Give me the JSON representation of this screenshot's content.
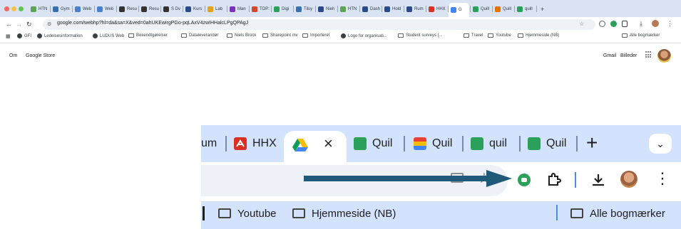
{
  "window": {
    "title": "google.com/webhp",
    "traffic_lights": [
      "#ed6a5e",
      "#f5bf4f",
      "#61c554"
    ]
  },
  "tabs": [
    {
      "label": "HTN",
      "icon": "globe-icon",
      "color": "#5aa454"
    },
    {
      "label": "Gym",
      "icon": "gym-icon",
      "color": "#3a6fb0"
    },
    {
      "label": "Web",
      "icon": "doc-icon",
      "color": "#4a7fd0"
    },
    {
      "label": "Web",
      "icon": "doc-icon",
      "color": "#4a7fd0"
    },
    {
      "label": "Resu",
      "icon": "github-icon",
      "color": "#333333"
    },
    {
      "label": "Resu",
      "icon": "github-icon",
      "color": "#333333"
    },
    {
      "label": "S Dv",
      "icon": "github-icon",
      "color": "#333333"
    },
    {
      "label": "Kurs",
      "icon": "lectio-icon",
      "color": "#2a4a8a"
    },
    {
      "label": "Lab",
      "icon": "lab-icon",
      "color": "#e3a21a"
    },
    {
      "label": "Man",
      "icon": "mail-icon",
      "color": "#7b2fbf"
    },
    {
      "label": "TOP:",
      "icon": "top-icon",
      "color": "#d9432a"
    },
    {
      "label": "Digi",
      "icon": "digi-icon",
      "color": "#2aa05a"
    },
    {
      "label": "Tilsy",
      "icon": "tilsy-icon",
      "color": "#3a6fb0"
    },
    {
      "label": "Nieh",
      "icon": "lectio-icon",
      "color": "#2a4a8a"
    },
    {
      "label": "HTN",
      "icon": "globe-icon",
      "color": "#5aa454"
    },
    {
      "label": "Dash",
      "icon": "lectio-icon",
      "color": "#2a4a8a"
    },
    {
      "label": "Hold",
      "icon": "ludus-icon",
      "color": "#2a4a8a"
    },
    {
      "label": "Rum",
      "icon": "lectio-icon",
      "color": "#2a4a8a"
    },
    {
      "label": "HHX",
      "icon": "pdf-icon",
      "color": "#d93025"
    },
    {
      "label": "G",
      "icon": "google-icon",
      "color": "#4285f4"
    },
    {
      "label": "Quill",
      "icon": "quill-icon",
      "color": "#2aa05a"
    },
    {
      "label": "Quill",
      "icon": "quill-icon",
      "color": "#e37400"
    },
    {
      "label": "quill",
      "icon": "quill-icon",
      "color": "#2aa05a"
    }
  ],
  "new_tab_label": "+",
  "address": {
    "url": "google.com/webhp?hl=da&sa=X&ved=0ahUKEwirgPGo-pqLAxV4zwIHHalcLPgQPAgJ"
  },
  "bookmarks": [
    {
      "label": "GFI",
      "icon": "github-icon"
    },
    {
      "label": "Ledelsesinformation",
      "icon": "circle-icon"
    },
    {
      "label": "LUDUS Web",
      "icon": "ludus-icon"
    },
    {
      "label": "Bekendtgørelser",
      "icon": "folder-icon"
    },
    {
      "label": "Dataleverandør",
      "icon": "folder-icon"
    },
    {
      "label": "Niels Brock",
      "icon": "folder-icon"
    },
    {
      "label": "Sharepoint mv",
      "icon": "folder-icon"
    },
    {
      "label": "Importeret",
      "icon": "folder-icon"
    },
    {
      "label": "Logo for organisati...",
      "icon": "x-logo-icon"
    },
    {
      "label": "Student surveys (...",
      "icon": "folder-icon"
    },
    {
      "label": "Travel",
      "icon": "folder-icon"
    },
    {
      "label": "Youtube",
      "icon": "folder-icon"
    },
    {
      "label": "Hjemmeside (NB)",
      "icon": "folder-icon"
    }
  ],
  "all_bookmarks_label": "Alle bogmærker",
  "google": {
    "left_links": [
      "Om",
      "Google Store"
    ],
    "right_links": [
      "Gmail",
      "Billeder"
    ]
  },
  "zoom": {
    "tab_partial_left": "um",
    "tab_hhx": "HHX",
    "tab_close": "×",
    "tab_quill1": "Quil",
    "tab_quill2": "Quil",
    "tab_quill3": "quil",
    "tab_quill4": "Quil",
    "new_tab": "+",
    "bookmark_youtube": "Youtube",
    "bookmark_hjemmeside": "Hjemmeside (NB)",
    "all_bookmarks": "Alle bogmærker",
    "arrow_color": "#1f5a78"
  }
}
